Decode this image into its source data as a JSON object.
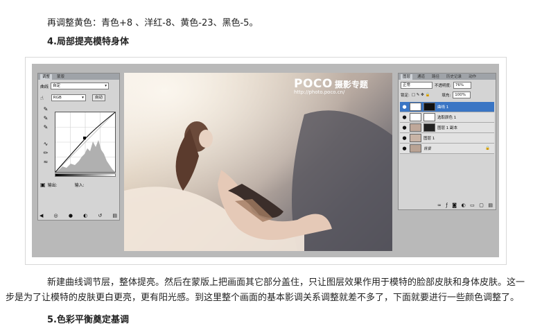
{
  "text": {
    "line1": "再调整黄色：青色+8 、洋红-8、黄色-23、黑色-5。",
    "heading4": "4.局部提亮模特身体",
    "para_line1": "新建曲线调节层，整体提亮。然后在蒙版上把画面其它部分盖住，只让图层效果作用于模特的脸部皮肤和身体皮肤。这一",
    "para_line2": "步是为了让模特的皮肤更白更亮，更有阳光感。到这里整个画面的基本影调关系调整就差不多了，下面就要进行一些颜色调整了。",
    "heading5": "5.色彩平衡奠定基调"
  },
  "curves_panel": {
    "tab_active": "调整",
    "tab_other": "蒙版",
    "title": "曲线",
    "preset": "自定",
    "channel": "RGB",
    "auto_button": "自动",
    "output_label": "输出:",
    "input_label": "输入:"
  },
  "watermark": {
    "logo": "POCO",
    "cn": "摄影专题",
    "url": "http://photo.poco.cn/"
  },
  "layers_panel": {
    "tab_active": "图层",
    "tab_others": [
      "通道",
      "路径",
      "历史记录",
      "动作"
    ],
    "blend_mode": "正常",
    "opacity_label": "不透明度:",
    "opacity_value": "76%",
    "lock_label": "锁定:",
    "fill_label": "填充:",
    "fill_value": "100%",
    "layers": [
      {
        "name": "曲线 1",
        "selected": true
      },
      {
        "name": "选取颜色 1",
        "selected": false
      },
      {
        "name": "图层 1 副本",
        "selected": false
      },
      {
        "name": "图层 1",
        "selected": false
      },
      {
        "name": "背景",
        "selected": false
      }
    ]
  },
  "colors": {
    "selected_layer": "#3a75c4",
    "panel_bg": "#d4d4d4"
  }
}
